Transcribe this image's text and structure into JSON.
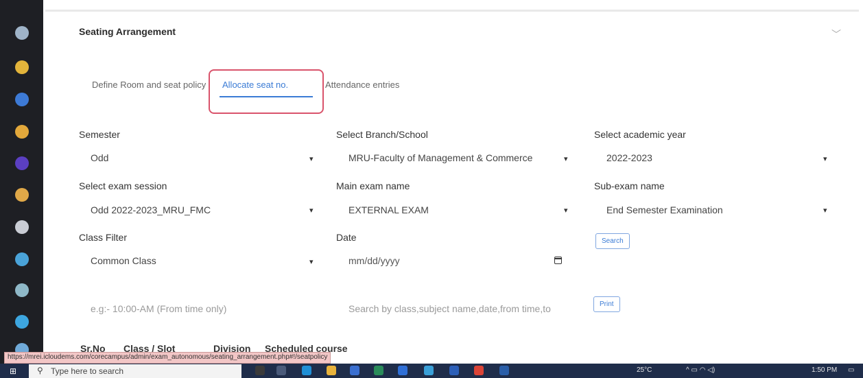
{
  "panel": {
    "title": "Seating Arrangement",
    "chevron": "﹀"
  },
  "tabs": [
    {
      "label": "Define Room and seat policy",
      "active": false
    },
    {
      "label": "Allocate seat no.",
      "active": true
    },
    {
      "label": "Attendance entries",
      "active": false
    }
  ],
  "form": {
    "semester": {
      "label": "Semester",
      "value": "Odd"
    },
    "branch": {
      "label": "Select Branch/School",
      "value": "MRU-Faculty of Management & Commerce"
    },
    "academic_year": {
      "label": "Select academic year",
      "value": "2022-2023"
    },
    "exam_session": {
      "label": "Select exam session",
      "value": "Odd 2022-2023_MRU_FMC"
    },
    "main_exam": {
      "label": "Main exam name",
      "value": "EXTERNAL EXAM"
    },
    "sub_exam": {
      "label": "Sub-exam name",
      "value": "End Semester Examination"
    },
    "class_filter": {
      "label": "Class Filter",
      "value": "Common Class"
    },
    "date": {
      "label": "Date",
      "placeholder": "mm/dd/yyyy"
    },
    "search_label": "Search",
    "time_placeholder": "e.g:- 10:00-AM (From time only)",
    "text_search_placeholder": "Search by class,subject name,date,from time,to",
    "print_label": "Print"
  },
  "table": {
    "headers": [
      "Sr.No",
      "Class / Slot",
      "Division",
      "Scheduled course"
    ]
  },
  "status_url": "https://mrei.icloudems.com/corecampus/admin/exam_autonomous/seating_arrangement.php#!/seatpolicy",
  "taskbar": {
    "search_placeholder": "Type here to search",
    "weather": "25°C",
    "clock": "1:50 PM"
  },
  "icons": {
    "caret": "▾",
    "search": "search-icon",
    "calendar": "calendar-icon",
    "start": "windows-start-icon"
  }
}
